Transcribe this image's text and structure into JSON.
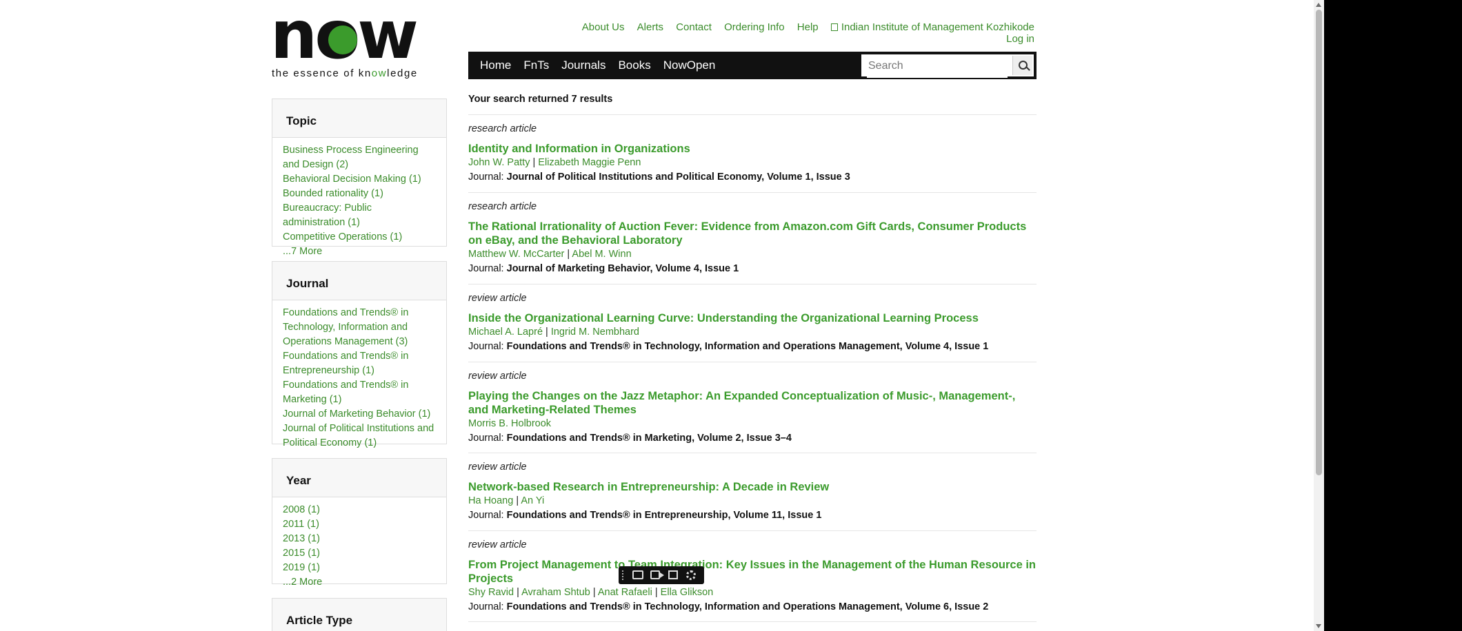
{
  "logo": {
    "word": "now",
    "tagline_pre": "the essence of kn",
    "tagline_green": "ow",
    "tagline_post": "ledge"
  },
  "toplinks": [
    "About Us",
    "Alerts",
    "Contact",
    "Ordering Info",
    "Help",
    "Indian Institute of Management Kozhikode",
    "Log in"
  ],
  "nav": {
    "items": [
      "Home",
      "FnTs",
      "Journals",
      "Books",
      "NowOpen"
    ],
    "search_placeholder": "Search"
  },
  "facets": [
    {
      "title": "Topic",
      "items": [
        "Business Process Engineering and Design (2)",
        "Behavioral Decision Making (1)",
        "Bounded rationality (1)",
        "Bureaucracy: Public administration (1)",
        "Competitive Operations (1)",
        "...7 More"
      ]
    },
    {
      "title": "Journal",
      "items": [
        "Foundations and Trends® in Technology, Information and Operations Management (3)",
        "Foundations and Trends® in Entrepreneurship (1)",
        "Foundations and Trends® in Marketing (1)",
        "Journal of Marketing Behavior (1)",
        "Journal of Political Institutions and Political Economy (1)"
      ]
    },
    {
      "title": "Year",
      "items": [
        "2008 (1)",
        "2011 (1)",
        "2013 (1)",
        "2015 (1)",
        "2019 (1)",
        "...2 More"
      ]
    },
    {
      "title": "Article Type",
      "items": []
    }
  ],
  "count_text": "Your search returned 7 results",
  "journal_prefix": "Journal:",
  "results": [
    {
      "type": "research article",
      "title": "Identity and Information in Organizations",
      "authors": [
        "John W. Patty",
        "Elizabeth Maggie Penn"
      ],
      "journal": "Journal of Political Institutions and Political Economy, Volume 1, Issue 3"
    },
    {
      "type": "research article",
      "title": "The Rational Irrationality of Auction Fever: Evidence from Amazon.com Gift Cards, Consumer Products on eBay, and the Behavioral Laboratory",
      "authors": [
        "Matthew W. McCarter",
        "Abel M. Winn"
      ],
      "journal": "Journal of Marketing Behavior, Volume 4, Issue 1"
    },
    {
      "type": "review article",
      "title": "Inside the Organizational Learning Curve: Understanding the Organizational Learning Process",
      "authors": [
        "Michael A. Lapré",
        "Ingrid M. Nembhard"
      ],
      "journal": "Foundations and Trends® in Technology, Information and Operations Management, Volume 4, Issue 1"
    },
    {
      "type": "review article",
      "title": "Playing the Changes on the Jazz Metaphor: An Expanded Conceptualization of Music-, Management-, and Marketing-Related Themes",
      "authors": [
        "Morris B. Holbrook"
      ],
      "journal": "Foundations and Trends® in Marketing, Volume 2, Issue 3–4"
    },
    {
      "type": "review article",
      "title": "Network-based Research in Entrepreneurship: A Decade in Review",
      "authors": [
        "Ha Hoang",
        "An Yi"
      ],
      "journal": "Foundations and Trends® in Entrepreneurship, Volume 11, Issue 1"
    },
    {
      "type": "review article",
      "title": "From Project Management to Team Integration: Key Issues in the Management of the Human Resource in Projects",
      "authors": [
        "Shy Ravid",
        "Avraham Shtub",
        "Anat Rafaeli",
        "Ella Glikson"
      ],
      "journal": "Foundations and Trends® in Technology, Information and Operations Management, Volume 6, Issue 2"
    }
  ],
  "colors": {
    "accent": "#3b9b2c",
    "link": "#3b8c2b",
    "navbar": "#111111"
  },
  "toolbar_icons": [
    "grip-icon",
    "camera-icon",
    "video-icon",
    "copy-icon",
    "gear-icon"
  ]
}
